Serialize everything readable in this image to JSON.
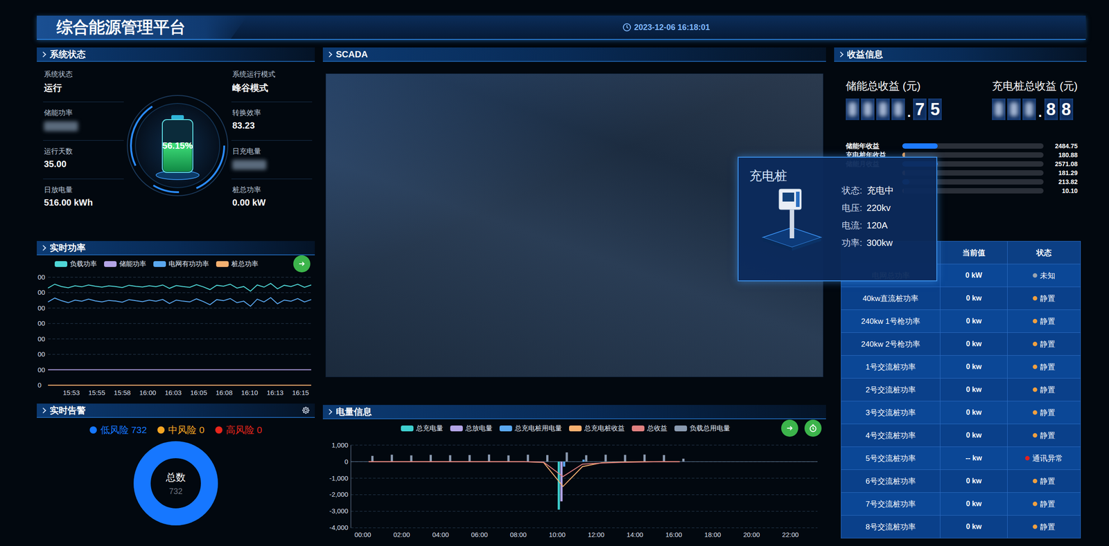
{
  "header": {
    "title": "综合能源管理平台",
    "datetime": "2023-12-06 16:18:01"
  },
  "system_status": {
    "title": "系统状态",
    "left_items": [
      {
        "label": "系统状态",
        "value": "运行",
        "masked": false
      },
      {
        "label": "储能功率",
        "value": "",
        "masked": true
      },
      {
        "label": "运行天数",
        "value": "35.00",
        "masked": false
      },
      {
        "label": "日放电量",
        "value": "516.00 kWh",
        "masked": false
      }
    ],
    "right_items": [
      {
        "label": "系统运行模式",
        "value": "峰谷模式",
        "masked": false
      },
      {
        "label": "转换效率",
        "value": "83.23",
        "masked": false
      },
      {
        "label": "日充电量",
        "value": "",
        "masked": true
      },
      {
        "label": "桩总功率",
        "value": "0.00 kW",
        "masked": false
      }
    ],
    "gauge": {
      "level": 0.5615,
      "reading": "56.15%"
    }
  },
  "realtime_power": {
    "title": "实时功率",
    "y_ticks": [
      "00",
      "00",
      "00",
      "00",
      "00",
      "00",
      "00",
      "0"
    ],
    "x_ticks": [
      "15:53",
      "15:55",
      "15:58",
      "16:00",
      "16:03",
      "16:05",
      "16:08",
      "16:10",
      "16:13",
      "16:15"
    ],
    "series": [
      {
        "name": "负载功率",
        "color": "#4fd6d6",
        "values": [
          630,
          655,
          640,
          632,
          645,
          638,
          650,
          642,
          636,
          644,
          640,
          633,
          648,
          641,
          637,
          645,
          639,
          650,
          628,
          646,
          640,
          635,
          652,
          638,
          620,
          648,
          642,
          655,
          630,
          640,
          610,
          650,
          636,
          660,
          625,
          648,
          640,
          655,
          635,
          650
        ]
      },
      {
        "name": "储能功率",
        "color": "#b3a4e6",
        "values": [
          100,
          100,
          100,
          100,
          100,
          100,
          100,
          100,
          100,
          100,
          100,
          100,
          100,
          100,
          100,
          100,
          100,
          100,
          100,
          100,
          100,
          100,
          100,
          100,
          100,
          100,
          100,
          100,
          100,
          100,
          100,
          100,
          100,
          100,
          100,
          100,
          100,
          100,
          100,
          100
        ]
      },
      {
        "name": "电网有功功率",
        "color": "#5aa8f0",
        "values": [
          540,
          565,
          548,
          535,
          552,
          545,
          558,
          547,
          540,
          550,
          546,
          538,
          555,
          548,
          542,
          552,
          545,
          556,
          530,
          552,
          545,
          540,
          560,
          543,
          522,
          555,
          548,
          562,
          535,
          545,
          512,
          558,
          540,
          568,
          528,
          552,
          545,
          562,
          540,
          555
        ]
      },
      {
        "name": "桩总功率",
        "color": "#f5b070",
        "values": [
          0,
          0,
          0,
          0,
          0,
          0,
          0,
          0,
          0,
          0,
          0,
          0,
          0,
          0,
          0,
          0,
          0,
          0,
          0,
          0,
          0,
          0,
          0,
          0,
          0,
          0,
          0,
          0,
          0,
          0,
          0,
          0,
          0,
          0,
          0,
          0,
          0,
          0,
          0,
          0
        ]
      }
    ]
  },
  "alarms": {
    "title": "实时告警",
    "legend": [
      {
        "label": "低风险 732",
        "color": "#1677ff"
      },
      {
        "label": "中风险 0",
        "color": "#f5a623"
      },
      {
        "label": "高风险 0",
        "color": "#e8261c"
      }
    ],
    "donut": {
      "label": "总数",
      "value": "732",
      "level": 1
    }
  },
  "scada": {
    "title": "SCADA"
  },
  "popup": {
    "title": "充电桩",
    "fields": [
      {
        "label": "状态:",
        "value": "充电中"
      },
      {
        "label": "电压:",
        "value": "220kv"
      },
      {
        "label": "电流:",
        "value": "120A"
      },
      {
        "label": "功率:",
        "value": "300kw"
      }
    ]
  },
  "energy": {
    "title": "电量信息",
    "y_ticks": [
      "1,000",
      "0",
      "-1,000",
      "-2,000",
      "-3,000",
      "-4,000"
    ],
    "x_ticks": [
      "00:00",
      "02:00",
      "04:00",
      "06:00",
      "08:00",
      "10:00",
      "12:00",
      "14:00",
      "16:00",
      "18:00",
      "20:00",
      "22:00"
    ],
    "series": [
      {
        "name": "总充电量",
        "color": "#3ecfcf",
        "kind": "bar",
        "values": [
          0,
          0,
          0,
          0,
          0,
          0,
          0,
          0,
          0,
          0,
          -2900,
          0,
          0,
          0,
          0,
          0,
          0
        ]
      },
      {
        "name": "总放电量",
        "color": "#b3a4e6",
        "kind": "bar",
        "values": [
          0,
          0,
          0,
          0,
          0,
          0,
          0,
          0,
          0,
          0,
          -2400,
          0,
          0,
          0,
          0,
          0,
          0
        ]
      },
      {
        "name": "总充电桩用电量",
        "color": "#5aa8f0",
        "kind": "bar",
        "values": [
          0,
          0,
          0,
          0,
          0,
          0,
          0,
          0,
          0,
          0,
          -300,
          120,
          0,
          0,
          0,
          0,
          0
        ]
      },
      {
        "name": "总充电桩收益",
        "color": "#f5b070",
        "kind": "line",
        "values": [
          0,
          0,
          0,
          0,
          0,
          0,
          0,
          0,
          0,
          -50,
          -1500,
          -300,
          -60,
          -20,
          0,
          0,
          0
        ]
      },
      {
        "name": "总收益",
        "color": "#e08080",
        "kind": "line",
        "values": [
          0,
          0,
          0,
          0,
          0,
          0,
          0,
          0,
          0,
          -30,
          -900,
          -150,
          -80,
          -40,
          -20,
          0,
          0
        ]
      },
      {
        "name": "负载总用电量",
        "color": "#8a9ab0",
        "kind": "bar",
        "values": [
          350,
          420,
          380,
          410,
          390,
          400,
          430,
          380,
          420,
          400,
          560,
          390,
          420,
          410,
          430,
          400,
          180
        ]
      }
    ]
  },
  "revenue": {
    "title": "收益信息",
    "totals": [
      {
        "label": "储能总收益 (元)",
        "masked_digits": 4,
        "visible_digits": [
          ".",
          "7",
          "5"
        ]
      },
      {
        "label": "充电桩总收益 (元)",
        "masked_digits": 3,
        "visible_digits": [
          ".",
          "8",
          "8"
        ]
      }
    ],
    "bars": [
      {
        "label": "储能年收益",
        "value": "2484.75",
        "level": 0.25,
        "color": "#1e7bff"
      },
      {
        "label": "充电桩年收益",
        "value": "180.88",
        "level": 0.02,
        "color": "#f0a050"
      },
      {
        "label": "储能月收益",
        "value": "2571.08",
        "level": 0.25,
        "color": "#1e7bff"
      },
      {
        "label": "",
        "value": "181.29",
        "level": 0.02,
        "color": "#f0a050"
      },
      {
        "label": "",
        "value": "213.82",
        "level": 0.05,
        "color": "#1e7bff"
      },
      {
        "label": "",
        "value": "10.10",
        "level": 0.01,
        "color": "#f0a050"
      }
    ]
  },
  "table": {
    "columns": [
      "",
      "当前值",
      "状态"
    ],
    "rows": [
      {
        "name": "电网总功率",
        "value": "0 kW",
        "status": "未知",
        "color": "#9aa4b0"
      },
      {
        "name": "40kw直流桩功率",
        "value": "0 kw",
        "status": "静置",
        "color": "#f0a040"
      },
      {
        "name": "240kw 1号枪功率",
        "value": "0 kw",
        "status": "静置",
        "color": "#f0a040"
      },
      {
        "name": "240kw 2号枪功率",
        "value": "0 kw",
        "status": "静置",
        "color": "#f0a040"
      },
      {
        "name": "1号交流桩功率",
        "value": "0 kw",
        "status": "静置",
        "color": "#f0a040"
      },
      {
        "name": "2号交流桩功率",
        "value": "0 kw",
        "status": "静置",
        "color": "#f0a040"
      },
      {
        "name": "3号交流桩功率",
        "value": "0 kw",
        "status": "静置",
        "color": "#f0a040"
      },
      {
        "name": "4号交流桩功率",
        "value": "0 kw",
        "status": "静置",
        "color": "#f0a040"
      },
      {
        "name": "5号交流桩功率",
        "value": "-- kw",
        "status": "通讯异常",
        "color": "#e02020"
      },
      {
        "name": "6号交流桩功率",
        "value": "0 kw",
        "status": "静置",
        "color": "#f0a040"
      },
      {
        "name": "7号交流桩功率",
        "value": "0 kw",
        "status": "静置",
        "color": "#f0a040"
      },
      {
        "name": "8号交流桩功率",
        "value": "0 kw",
        "status": "静置",
        "color": "#f0a040"
      }
    ]
  }
}
